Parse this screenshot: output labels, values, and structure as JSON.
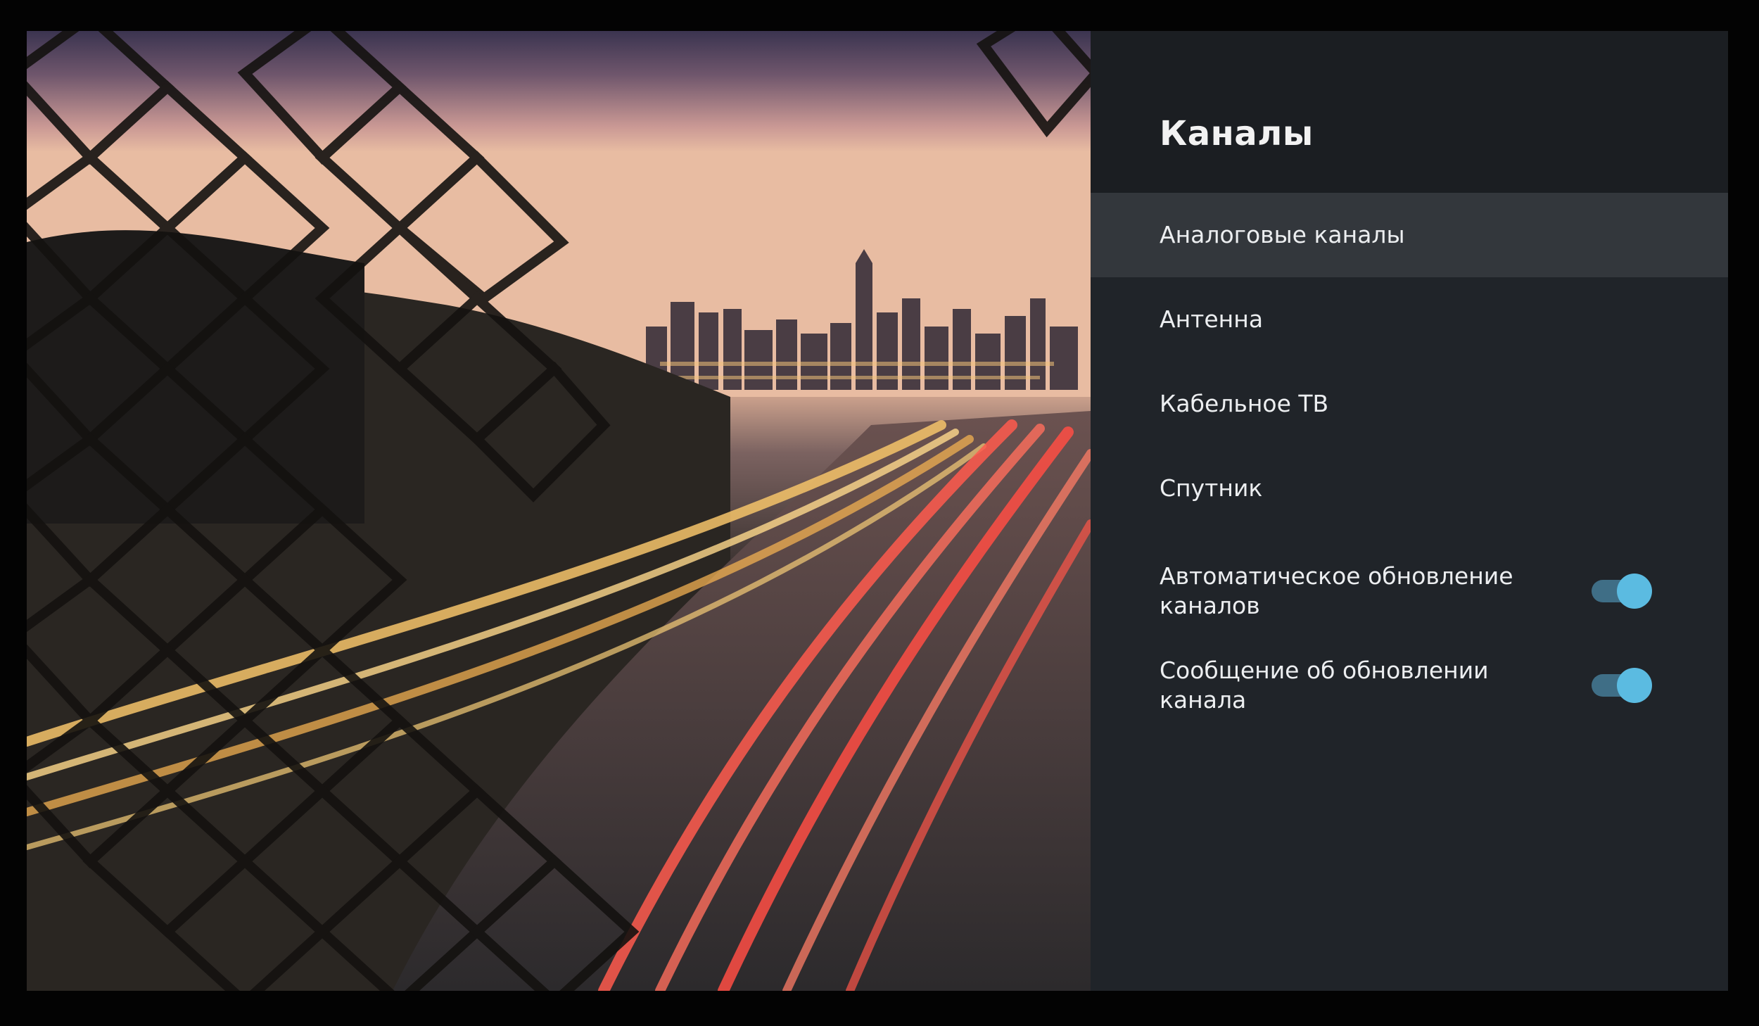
{
  "panel": {
    "title": "Каналы",
    "items": [
      {
        "label": "Аналоговые каналы",
        "selected": true
      },
      {
        "label": "Антенна"
      },
      {
        "label": "Кабельное ТВ"
      },
      {
        "label": "Спутник"
      },
      {
        "label": "Автоматическое обновление каналов",
        "toggle": true
      },
      {
        "label": "Сообщение об обновлении канала",
        "toggle": true
      }
    ]
  },
  "colors": {
    "toggle_accent": "#5bbbe1",
    "panel_background": "#202429",
    "selected_row": "#33373c"
  }
}
